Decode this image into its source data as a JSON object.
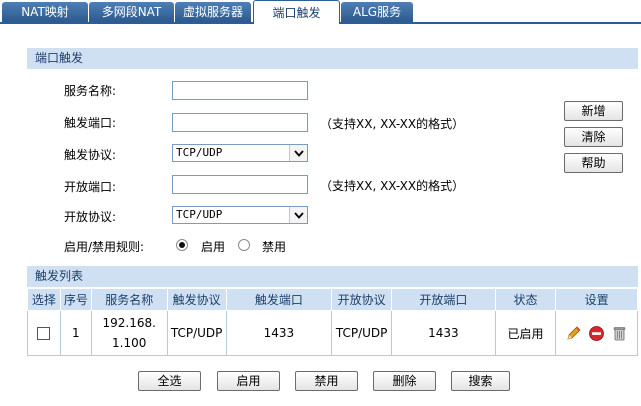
{
  "tabs": [
    {
      "label": "NAT映射",
      "active": false
    },
    {
      "label": "多网段NAT",
      "active": false
    },
    {
      "label": "虚拟服务器",
      "active": false
    },
    {
      "label": "端口触发",
      "active": true
    },
    {
      "label": "ALG服务",
      "active": false
    }
  ],
  "form": {
    "section_title": "端口触发",
    "service_name_label": "服务名称:",
    "service_name_value": "",
    "trigger_port_label": "触发端口:",
    "trigger_port_value": "",
    "trigger_port_hint": "（支持XX, XX-XX的格式）",
    "trigger_protocol_label": "触发协议:",
    "trigger_protocol_value": "TCP/UDP",
    "open_port_label": "开放端口:",
    "open_port_value": "",
    "open_port_hint": "（支持XX, XX-XX的格式）",
    "open_protocol_label": "开放协议:",
    "open_protocol_value": "TCP/UDP",
    "rule_label": "启用/禁用规则:",
    "enable_label": "启用",
    "disable_label": "禁用",
    "rule_state": "enable"
  },
  "side_buttons": {
    "add": "新增",
    "clear": "清除",
    "help": "帮助"
  },
  "list": {
    "section_title": "触发列表",
    "headers": [
      "选择",
      "序号",
      "服务名称",
      "触发协议",
      "触发端口",
      "开放协议",
      "开放端口",
      "状态",
      "设置"
    ],
    "rows": [
      {
        "selected": false,
        "index": "1",
        "name_line1": "192.168.",
        "name_line2": "1.100",
        "trigger_protocol": "TCP/UDP",
        "trigger_port": "1433",
        "open_protocol": "TCP/UDP",
        "open_port": "1433",
        "status": "已启用",
        "actions": [
          "edit-pencil-icon",
          "disable-icon",
          "trash-icon"
        ]
      }
    ]
  },
  "bottom_buttons": {
    "select_all": "全选",
    "enable": "启用",
    "disable": "禁用",
    "delete": "删除",
    "search": "搜索"
  },
  "colors": {
    "tab_bg": "#3a6aa3",
    "section_bg": "#cfe0f2",
    "section_text": "#1d3f6a",
    "delete_icon": "#d9262b",
    "pencil": "#e6a11a"
  }
}
